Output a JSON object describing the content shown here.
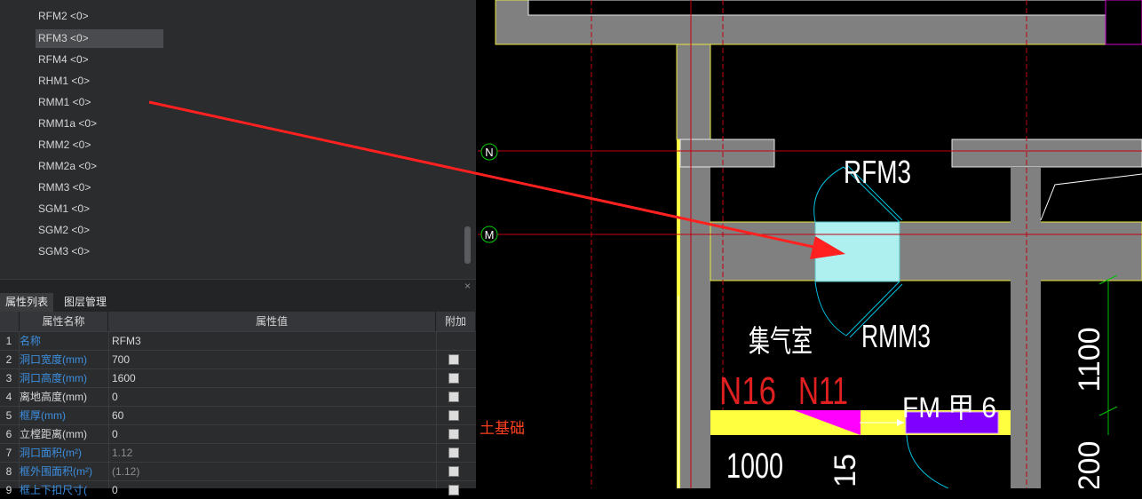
{
  "tree": {
    "items": [
      {
        "label": "RFM2 <0>",
        "selected": false
      },
      {
        "label": "RFM3 <0>",
        "selected": true
      },
      {
        "label": "RFM4 <0>",
        "selected": false
      },
      {
        "label": "RHM1 <0>",
        "selected": false
      },
      {
        "label": "RMM1 <0>",
        "selected": false
      },
      {
        "label": "RMM1a <0>",
        "selected": false
      },
      {
        "label": "RMM2 <0>",
        "selected": false
      },
      {
        "label": "RMM2a <0>",
        "selected": false
      },
      {
        "label": "RMM3 <0>",
        "selected": false
      },
      {
        "label": "SGM1 <0>",
        "selected": false
      },
      {
        "label": "SGM2 <0>",
        "selected": false
      },
      {
        "label": "SGM3 <0>",
        "selected": false
      }
    ]
  },
  "panel": {
    "close_icon": "×",
    "tabs": [
      {
        "label": "属性列表",
        "active": true
      },
      {
        "label": "图层管理",
        "active": false
      }
    ],
    "headers": {
      "name": "属性名称",
      "value": "属性值",
      "extra": "附加"
    },
    "rows": [
      {
        "index": "1",
        "name": "名称",
        "value": "RFM3",
        "blue": true,
        "dim": false,
        "checkbox": false
      },
      {
        "index": "2",
        "name": "洞口宽度(mm)",
        "value": "700",
        "blue": true,
        "dim": false,
        "checkbox": true
      },
      {
        "index": "3",
        "name": "洞口高度(mm)",
        "value": "1600",
        "blue": true,
        "dim": false,
        "checkbox": true
      },
      {
        "index": "4",
        "name": "离地高度(mm)",
        "value": "0",
        "blue": false,
        "dim": false,
        "checkbox": true
      },
      {
        "index": "5",
        "name": "框厚(mm)",
        "value": "60",
        "blue": true,
        "dim": false,
        "checkbox": true
      },
      {
        "index": "6",
        "name": "立樘距离(mm)",
        "value": "0",
        "blue": false,
        "dim": false,
        "checkbox": true
      },
      {
        "index": "7",
        "name": "洞口面积(m²)",
        "value": "1.12",
        "blue": true,
        "dim": true,
        "checkbox": true
      },
      {
        "index": "8",
        "name": "框外围面积(m²)",
        "value": "(1.12)",
        "blue": true,
        "dim": true,
        "checkbox": true
      },
      {
        "index": "9",
        "name": "框上下扣尺寸(",
        "value": "0",
        "blue": true,
        "dim": false,
        "checkbox": true
      }
    ]
  },
  "cad": {
    "axis_labels": [
      "N",
      "M"
    ],
    "door_labels": [
      "RFM3",
      "RMM3"
    ],
    "room_label": "集气室",
    "grid_labels": [
      "N16",
      "N11"
    ],
    "fm_label": "FM 甲 6",
    "dimensions": [
      "1100",
      "1000",
      "200",
      "15"
    ],
    "side_text": "土基础",
    "colors": {
      "wall": "#808080",
      "selected_door": "#aef0f0",
      "grid": "#e0001a",
      "annotation": "#ff0000"
    }
  }
}
